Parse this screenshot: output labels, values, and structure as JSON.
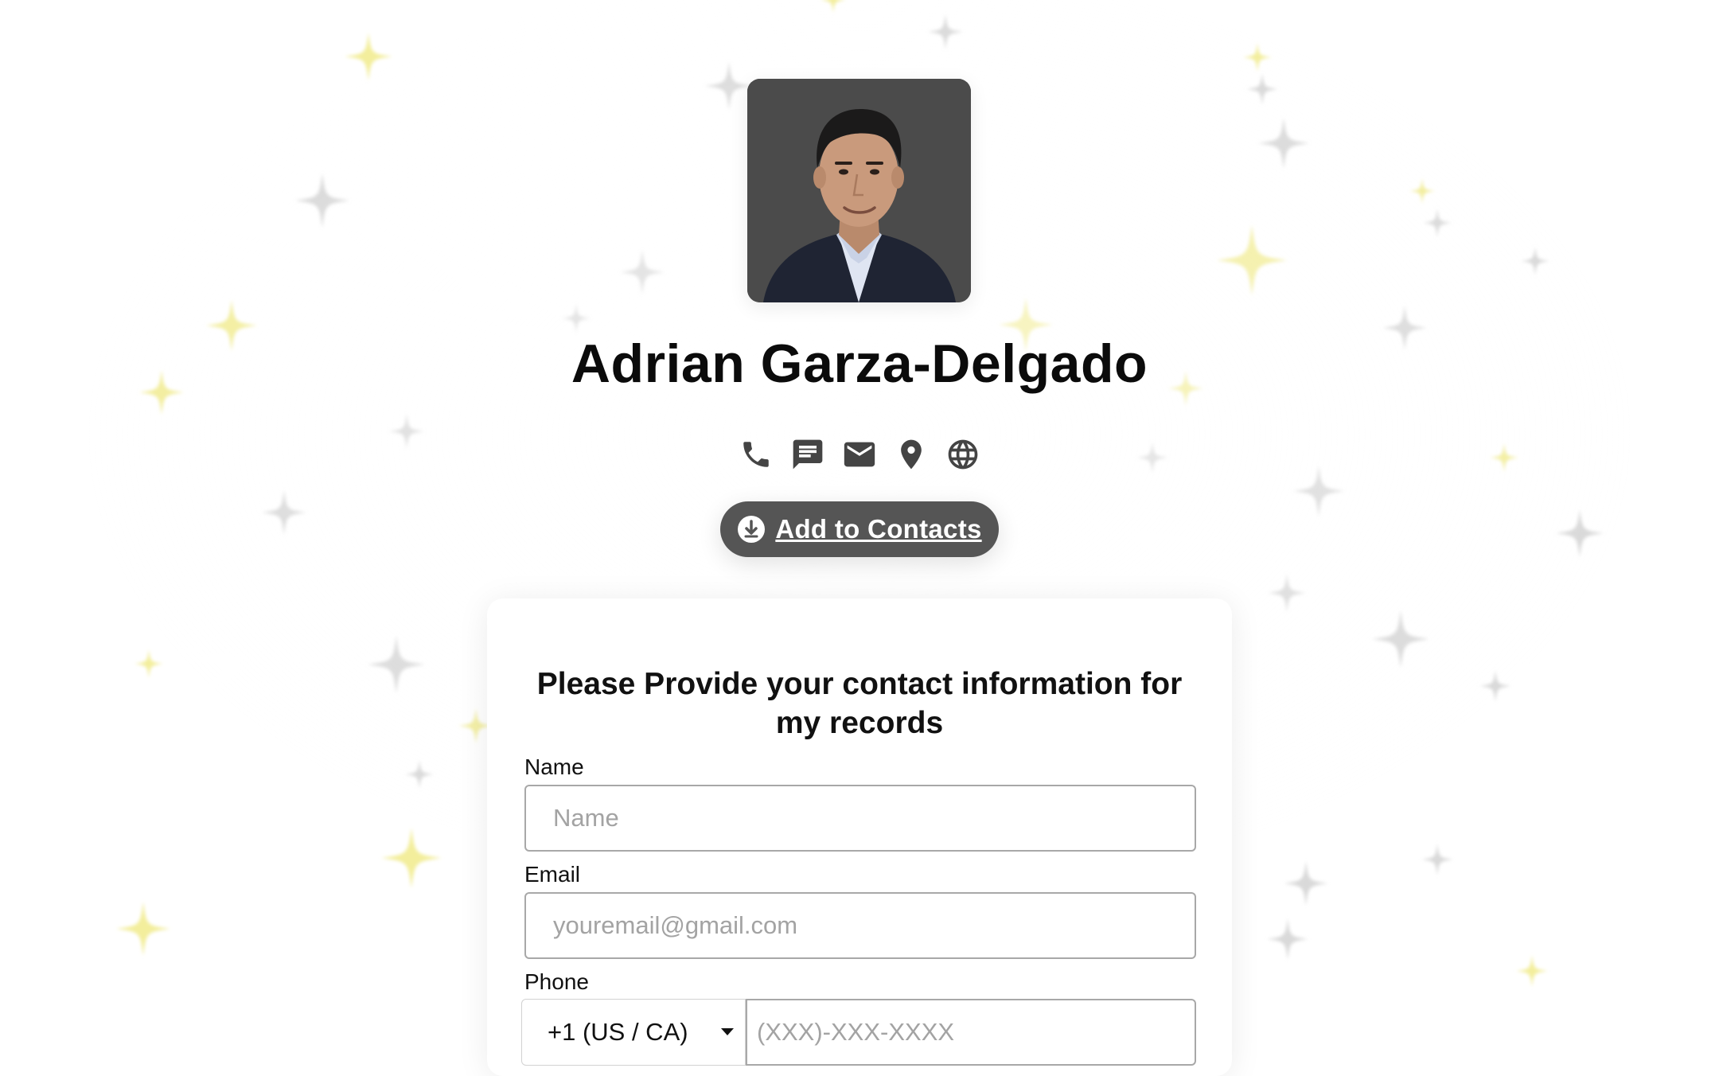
{
  "profile": {
    "name": "Adrian Garza-Delgado",
    "photo_alt": "Profile photo of Adrian Garza-Delgado"
  },
  "actions": {
    "icons": [
      "phone-icon",
      "message-icon",
      "email-icon",
      "location-pin-icon",
      "globe-icon"
    ],
    "add_contacts_label": "Add to Contacts"
  },
  "form": {
    "title": "Please Provide your contact information for my records",
    "name_label": "Name",
    "name_placeholder": "Name",
    "email_label": "Email",
    "email_placeholder": "youremail@gmail.com",
    "phone_label": "Phone",
    "country_code": "+1 (US / CA)",
    "phone_placeholder": "(XXX)-XXX-XXXX"
  },
  "colors": {
    "accent_button": "#555555",
    "icon": "#444444",
    "star_gray": "#d6d6d6",
    "star_yellow": "#f4ef9f"
  }
}
